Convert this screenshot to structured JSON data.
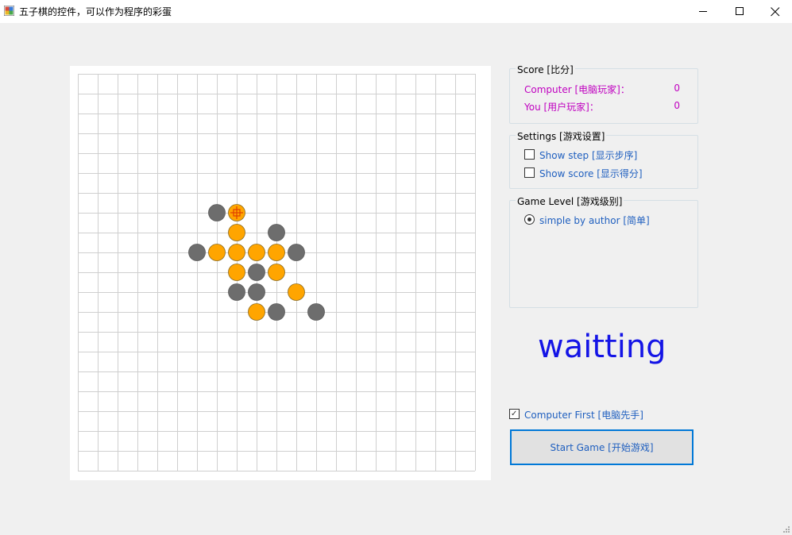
{
  "window": {
    "title": "五子棋的控件，可以作为程序的彩蛋",
    "minimize_icon": "minimize-icon",
    "maximize_icon": "maximize-icon",
    "close_icon": "close-icon"
  },
  "board": {
    "size": 20,
    "colors": {
      "computer": "#6d6d6d",
      "user": "#ffa500",
      "last_move_mark": "#e04000",
      "grid": "#cfcfcf"
    },
    "stones": [
      {
        "row": 7,
        "col": 7,
        "player": "computer"
      },
      {
        "row": 7,
        "col": 8,
        "player": "user",
        "last": true
      },
      {
        "row": 8,
        "col": 8,
        "player": "user"
      },
      {
        "row": 8,
        "col": 10,
        "player": "computer"
      },
      {
        "row": 9,
        "col": 6,
        "player": "computer"
      },
      {
        "row": 9,
        "col": 7,
        "player": "user"
      },
      {
        "row": 9,
        "col": 8,
        "player": "user"
      },
      {
        "row": 9,
        "col": 9,
        "player": "user"
      },
      {
        "row": 9,
        "col": 10,
        "player": "user"
      },
      {
        "row": 9,
        "col": 11,
        "player": "computer"
      },
      {
        "row": 10,
        "col": 8,
        "player": "user"
      },
      {
        "row": 10,
        "col": 9,
        "player": "computer"
      },
      {
        "row": 10,
        "col": 10,
        "player": "user"
      },
      {
        "row": 11,
        "col": 8,
        "player": "computer"
      },
      {
        "row": 11,
        "col": 9,
        "player": "computer"
      },
      {
        "row": 11,
        "col": 11,
        "player": "user"
      },
      {
        "row": 12,
        "col": 9,
        "player": "user"
      },
      {
        "row": 12,
        "col": 10,
        "player": "computer"
      },
      {
        "row": 12,
        "col": 12,
        "player": "computer"
      }
    ]
  },
  "score": {
    "legend": "Score [比分]",
    "computer_label": "Computer [电脑玩家]：",
    "computer_value": "0",
    "user_label": "You [用户玩家]：",
    "user_value": "0"
  },
  "settings": {
    "legend": "Settings [游戏设置]",
    "show_step_label": "Show step [显示步序]",
    "show_step_checked": false,
    "show_score_label": "Show score [显示得分]",
    "show_score_checked": false
  },
  "level": {
    "legend": "Game Level [游戏级别]",
    "simple_label": "simple by author [简单]",
    "simple_selected": true
  },
  "status": {
    "text": "waitting"
  },
  "computer_first": {
    "label": "Computer First [电脑先手]",
    "checked": true
  },
  "start_button": {
    "label": "Start Game [开始游戏]"
  }
}
